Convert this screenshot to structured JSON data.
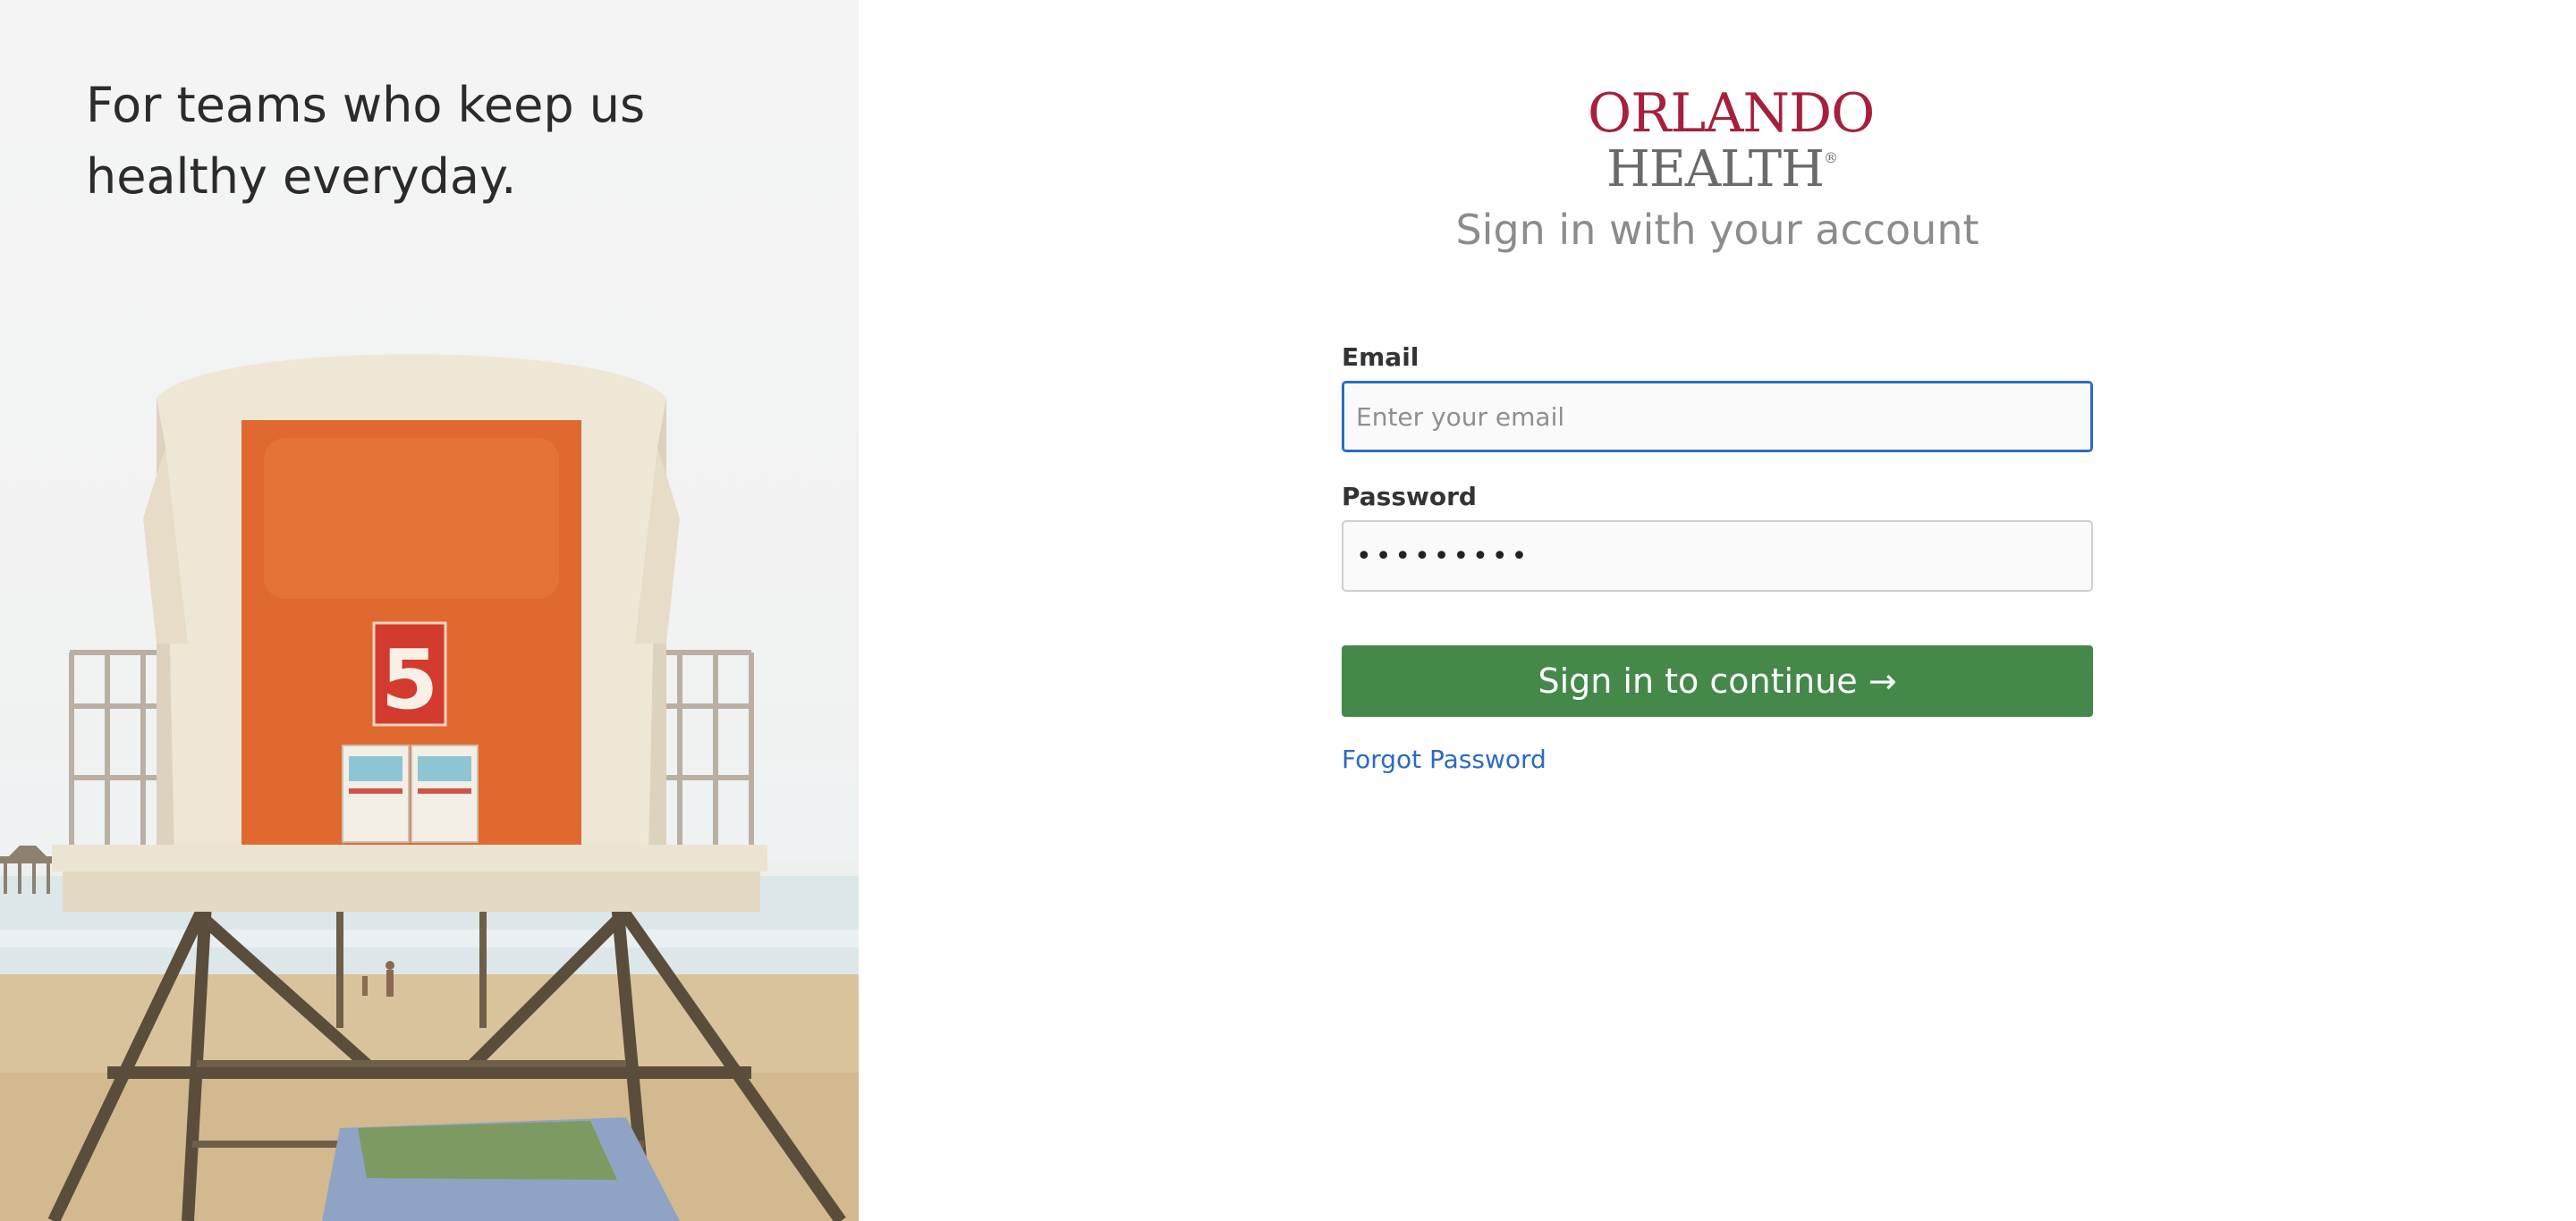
{
  "hero": {
    "tagline": "For teams who keep us\nhealthy everyday.",
    "photo_subject": "lifeguard tower on beach",
    "tower_number": "5"
  },
  "logo": {
    "line1": "ORLANDO",
    "line2": "HEALTH",
    "registered_mark": "®"
  },
  "signin": {
    "heading": "Sign in with your account"
  },
  "form": {
    "email": {
      "label": "Email",
      "placeholder": "Enter your email",
      "value": ""
    },
    "password": {
      "label": "Password",
      "value": "•••••••••"
    },
    "submit_label": "Sign in to continue →",
    "forgot_label": "Forgot Password"
  },
  "colors": {
    "brand_red": "#a6203e",
    "brand_gray": "#6a6a6a",
    "button_green": "#44884a",
    "link_blue": "#2a6bc3",
    "focus_blue": "#2a6bc3"
  }
}
